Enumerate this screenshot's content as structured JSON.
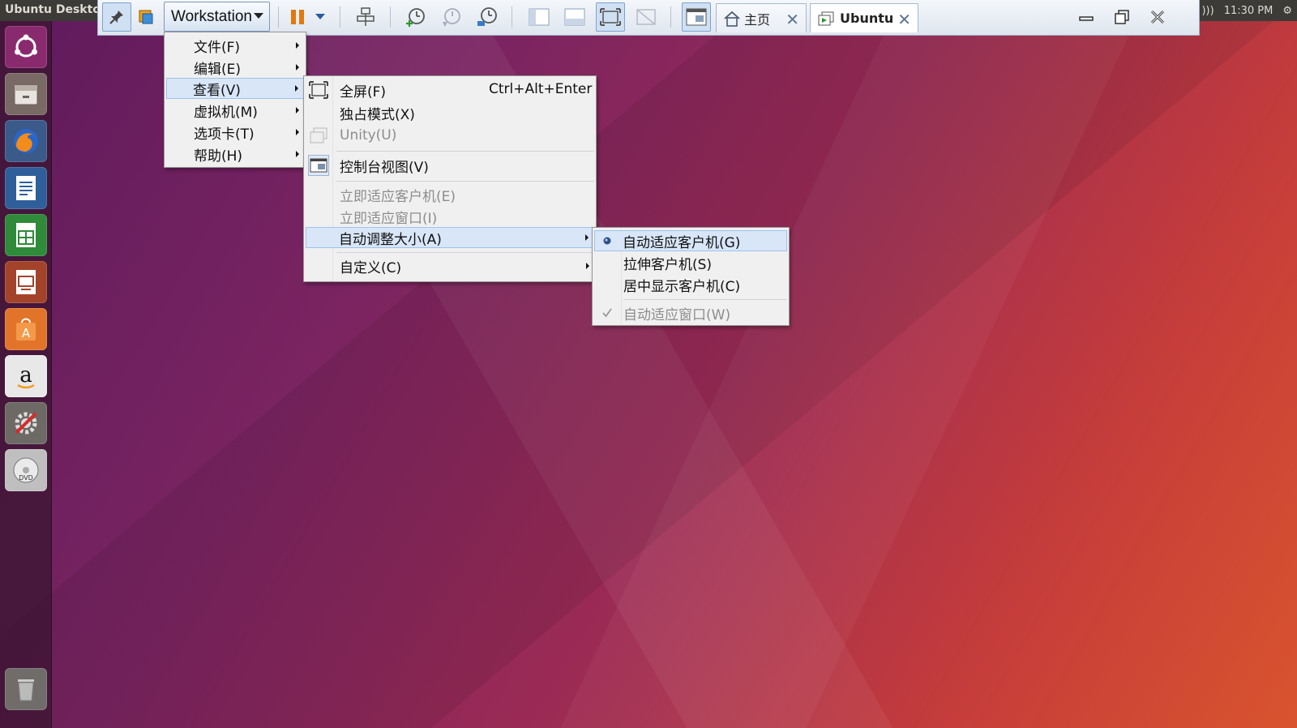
{
  "panel": {
    "title": "Ubuntu Desktop",
    "time": "11:30 PM"
  },
  "launcher": {
    "items": [
      "ubuntu-dash",
      "files",
      "firefox",
      "libreoffice-writer",
      "libreoffice-calc",
      "libreoffice-impress",
      "ubuntu-software",
      "amazon",
      "system-settings",
      "dvd",
      "trash"
    ]
  },
  "toolbar": {
    "workstation_label": "Workstation",
    "tabs": [
      {
        "label": "主页",
        "active": false
      },
      {
        "label": "Ubuntu",
        "active": true
      }
    ],
    "close_glyph": "✕"
  },
  "main_menu": {
    "items": [
      {
        "label": "文件(F)"
      },
      {
        "label": "编辑(E)"
      },
      {
        "label": "查看(V)"
      },
      {
        "label": "虚拟机(M)"
      },
      {
        "label": "选项卡(T)"
      },
      {
        "label": "帮助(H)"
      }
    ]
  },
  "view_menu": {
    "items": [
      {
        "label": "全屏(F)",
        "shortcut": "Ctrl+Alt+Enter"
      },
      {
        "label": "独占模式(X)"
      },
      {
        "label": "Unity(U)"
      },
      {
        "label": "控制台视图(V)"
      },
      {
        "label": "立即适应客户机(E)"
      },
      {
        "label": "立即适应窗口(I)"
      },
      {
        "label": "自动调整大小(A)"
      },
      {
        "label": "自定义(C)"
      }
    ]
  },
  "autosize_menu": {
    "items": [
      {
        "label": "自动适应客户机(G)"
      },
      {
        "label": "拉伸客户机(S)"
      },
      {
        "label": "居中显示客户机(C)"
      },
      {
        "label": "自动适应窗口(W)"
      }
    ]
  },
  "colors": {
    "menu_bg": "#f0f0f0",
    "highlight": "#d8e6f8",
    "disabled": "#8d8d8d"
  }
}
